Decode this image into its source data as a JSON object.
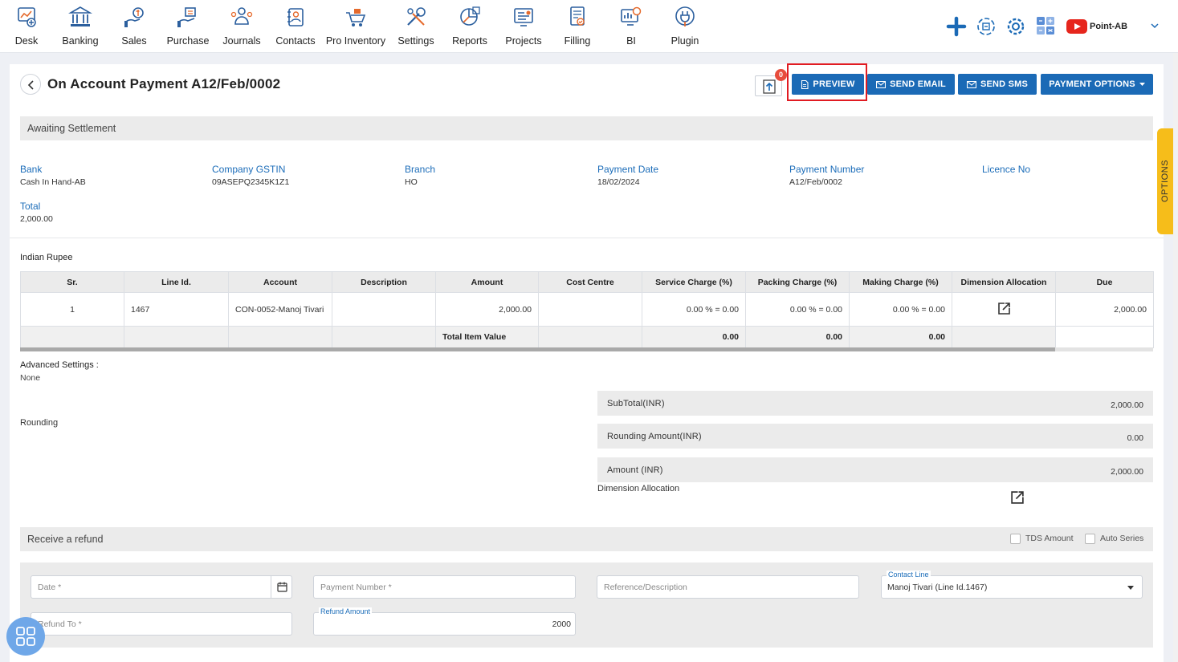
{
  "nav": {
    "items": [
      {
        "label": "Desk",
        "icon": "desk-icon"
      },
      {
        "label": "Banking",
        "icon": "bank-icon"
      },
      {
        "label": "Sales",
        "icon": "sales-icon"
      },
      {
        "label": "Purchase",
        "icon": "purchase-icon"
      },
      {
        "label": "Journals",
        "icon": "journals-icon"
      },
      {
        "label": "Contacts",
        "icon": "contacts-icon"
      },
      {
        "label": "Pro Inventory",
        "icon": "inventory-icon"
      },
      {
        "label": "Settings",
        "icon": "settings-tools-icon"
      },
      {
        "label": "Reports",
        "icon": "reports-icon"
      },
      {
        "label": "Projects",
        "icon": "projects-icon"
      },
      {
        "label": "Filling",
        "icon": "filling-icon"
      },
      {
        "label": "BI",
        "icon": "bi-icon"
      },
      {
        "label": "Plugin",
        "icon": "plugin-icon"
      }
    ],
    "org_name": "Point-AB",
    "accent": "#1b6ab6"
  },
  "header": {
    "title": "On Account Payment A12/Feb/0002",
    "upload_badge": "0",
    "buttons": {
      "preview": "PREVIEW",
      "send_email": "SEND EMAIL",
      "send_sms": "SEND SMS",
      "payment_options": "PAYMENT OPTIONS"
    }
  },
  "status": "Awaiting Settlement",
  "options_tab": "OPTIONS",
  "fields": {
    "bank": {
      "label": "Bank",
      "value": "Cash In Hand-AB"
    },
    "gstin": {
      "label": "Company GSTIN",
      "value": "09ASEPQ2345K1Z1"
    },
    "branch": {
      "label": "Branch",
      "value": "HO"
    },
    "payment_date": {
      "label": "Payment Date",
      "value": "18/02/2024"
    },
    "payment_number": {
      "label": "Payment Number",
      "value": "A12/Feb/0002"
    },
    "licence": {
      "label": "Licence No",
      "value": ""
    },
    "total": {
      "label": "Total",
      "value": "2,000.00"
    }
  },
  "currency": "Indian Rupee",
  "table": {
    "headers": [
      "Sr.",
      "Line Id.",
      "Account",
      "Description",
      "Amount",
      "Cost Centre",
      "Service Charge (%)",
      "Packing Charge (%)",
      "Making Charge (%)",
      "Dimension Allocation",
      "Due"
    ],
    "rows": [
      {
        "sr": "1",
        "line_id": "1467",
        "account": "CON-0052-Manoj Tivari",
        "description": "",
        "amount": "2,000.00",
        "cost_centre": "",
        "service": "0.00 % = 0.00",
        "packing": "0.00 % = 0.00",
        "making": "0.00 % = 0.00",
        "due": "2,000.00"
      }
    ],
    "footer": {
      "label": "Total Item Value",
      "service": "0.00",
      "packing": "0.00",
      "making": "0.00"
    }
  },
  "advanced": {
    "label": "Advanced Settings :",
    "value": "None"
  },
  "rounding_label": "Rounding",
  "summary": {
    "subtotal": {
      "label": "SubTotal(INR)",
      "value": "2,000.00"
    },
    "rounding": {
      "label": "Rounding Amount(INR)",
      "value": "0.00"
    },
    "amount": {
      "label": "Amount (INR)",
      "value": "2,000.00"
    },
    "dimension_label": "Dimension Allocation"
  },
  "refund": {
    "title": "Receive a refund",
    "tds_label": "TDS Amount",
    "auto_series_label": "Auto Series",
    "date_placeholder": "Date *",
    "payment_number_placeholder": "Payment Number *",
    "reference_placeholder": "Reference/Description",
    "contact_line_label": "Contact Line",
    "contact_line_value": "Manoj Tivari (Line Id.1467)",
    "refund_to_placeholder": "Refund To *",
    "refund_amount_label": "Refund Amount",
    "refund_amount_value": "2000"
  }
}
